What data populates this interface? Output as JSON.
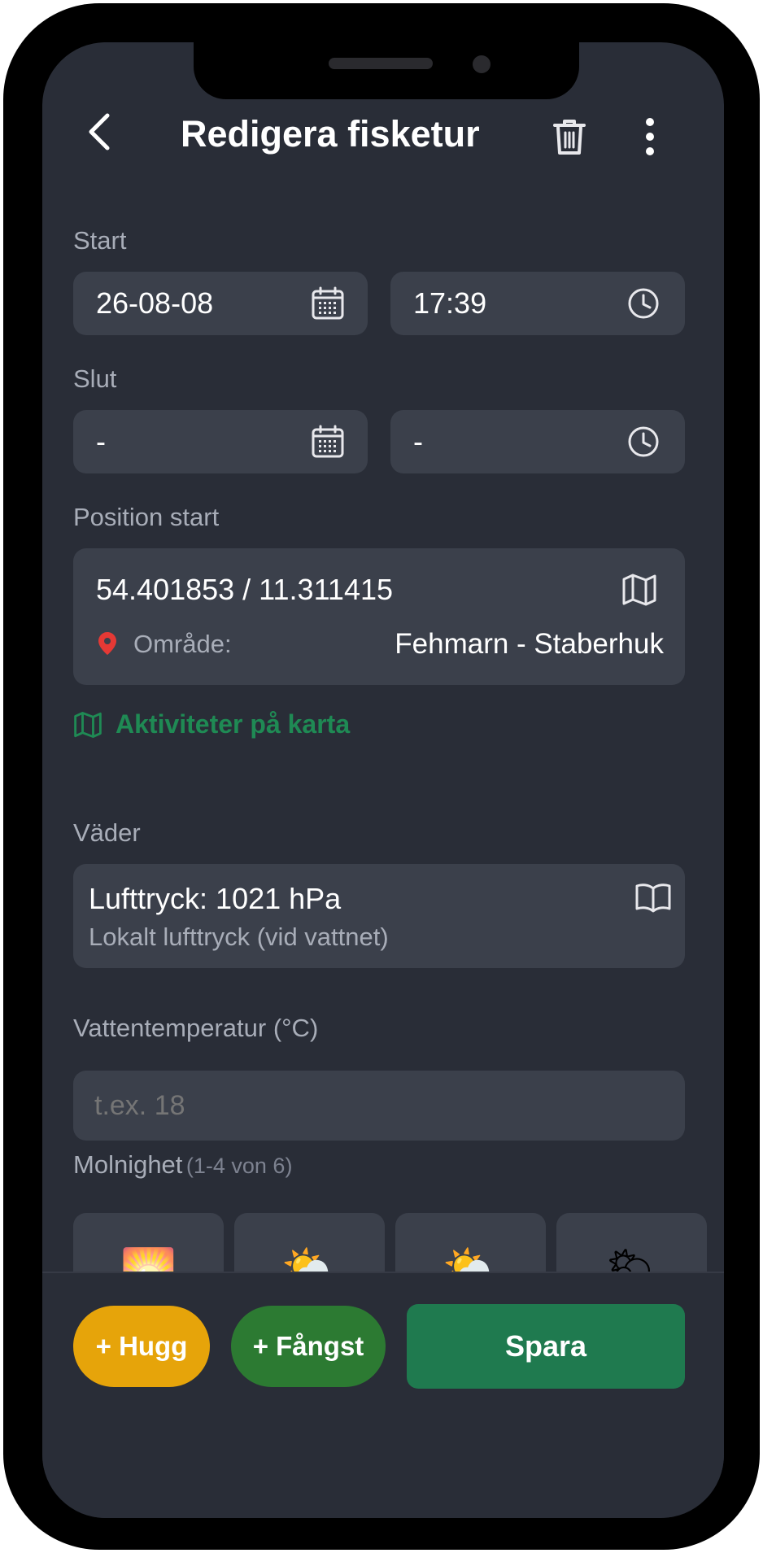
{
  "header": {
    "title": "Redigera fisketur",
    "back_icon": "back-arrow-icon",
    "delete_icon": "trash-icon",
    "menu_icon": "more-vertical-icon"
  },
  "start": {
    "label": "Start",
    "date": "26-08-08",
    "time": "17:39"
  },
  "end": {
    "label": "Slut",
    "date": "-",
    "time": "-"
  },
  "position": {
    "label": "Position start",
    "coordinates": "54.401853 / 11.311415",
    "area_label": "Område:",
    "area_value": "Fehmarn - Staberhuk"
  },
  "map_link": {
    "label": "Aktiviteter på karta"
  },
  "weather": {
    "label": "Väder",
    "pressure": "Lufttryck: 1021 hPa",
    "pressure_note": "Lokalt lufttryck (vid vattnet)"
  },
  "water_temp": {
    "label": "Vattentemperatur (°C)",
    "placeholder": "t.ex. 18",
    "value": ""
  },
  "clouds": {
    "label": "Molnighet",
    "hint": "(1-4 von 6)",
    "options": [
      {
        "emoji": "🌅",
        "name": "sunrise"
      },
      {
        "emoji": "⛅",
        "name": "sun-behind-cloud"
      },
      {
        "emoji": "⛅",
        "name": "partly-cloudy"
      },
      {
        "emoji": "🌥",
        "name": "mostly-cloudy"
      }
    ]
  },
  "actions": {
    "hugg": "+ Hugg",
    "fangst": "+ Fångst",
    "spara": "Spara"
  },
  "colors": {
    "background": "#292d37",
    "field": "#3b404b",
    "accent_green": "#1f7a4f",
    "link_green": "#1f8a54",
    "hugg_yellow": "#e6a40a",
    "fangst_green": "#2c7a32"
  }
}
